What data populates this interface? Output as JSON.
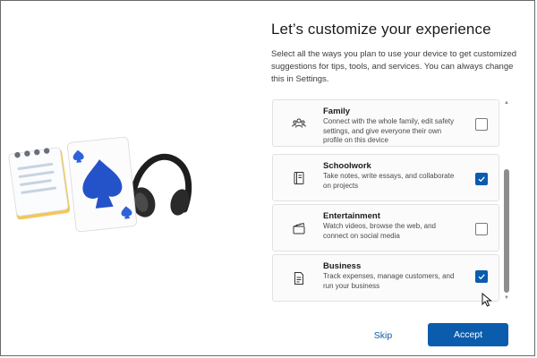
{
  "page": {
    "title": "Let’s customize your experience",
    "description": "Select all the ways you plan to use your device to get customized suggestions for tips, tools, and services. You can always change this in Settings."
  },
  "options": [
    {
      "name": "Family",
      "description": "Connect with the whole family, edit safety settings, and give everyone their own profile on this device",
      "checked": false,
      "icon": "family-icon"
    },
    {
      "name": "Schoolwork",
      "description": "Take notes, write essays, and collaborate on projects",
      "checked": true,
      "icon": "notebook-icon"
    },
    {
      "name": "Entertainment",
      "description": "Watch videos, browse the web, and connect on social media",
      "checked": false,
      "icon": "clapperboard-icon"
    },
    {
      "name": "Business",
      "description": "Track expenses, manage customers, and run your business",
      "checked": true,
      "icon": "document-icon"
    }
  ],
  "buttons": {
    "skip": "Skip",
    "accept": "Accept"
  },
  "colors": {
    "accent": "#0b5cad",
    "card_background": "#fbfbfb",
    "text": "#1b1b1b"
  }
}
